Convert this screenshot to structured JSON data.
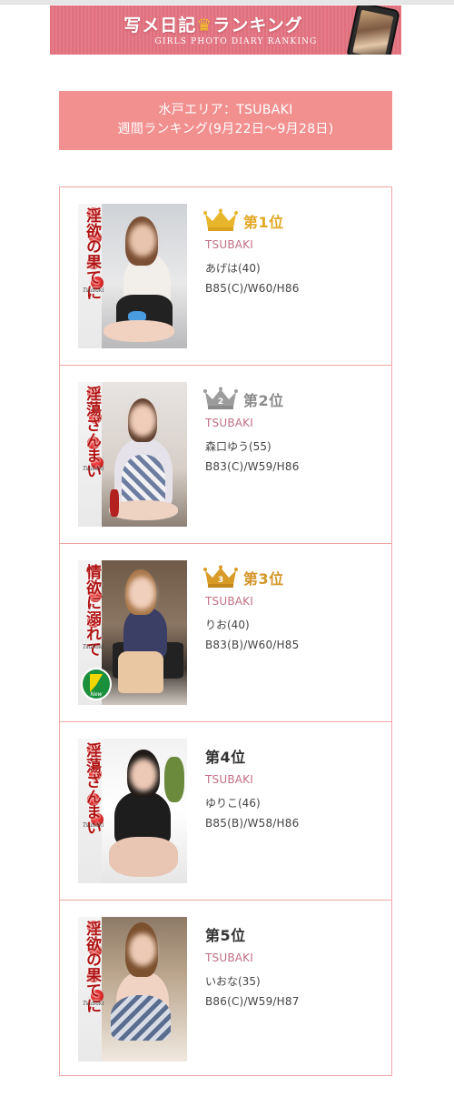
{
  "banner": {
    "title_left": "写メ日記",
    "title_crown": "♛",
    "title_right": "ランキング",
    "subtitle": "GIRLS PHOTO DIARY RANKING"
  },
  "heading": {
    "line1": "水戸エリア：TSUBAKI",
    "line2": "週間ランキング(9月22日〜9月28日)"
  },
  "colors": {
    "accent_pink": "#f28f8f",
    "border_pink": "#f0a5a5",
    "shop_name": "#c16f84",
    "gold": "#e8b62c",
    "silver": "#999999",
    "bronze": "#d49a2a"
  },
  "rankings": [
    {
      "rank_label": "第1位",
      "crown": "gold",
      "shop": "TSUBAKI",
      "name": "あげは(40)",
      "size": "B85(C)/W60/H86",
      "photo_caption": "淫欲の果てに",
      "photo_shop": "Tsubaki"
    },
    {
      "rank_label": "第2位",
      "crown": "silver",
      "crown_number": "2",
      "shop": "TSUBAKI",
      "name": "森口ゆう(55)",
      "size": "B83(C)/W59/H86",
      "photo_caption": "淫蕩ざんまい",
      "photo_shop": "Tsubaki"
    },
    {
      "rank_label": "第3位",
      "crown": "bronze",
      "crown_number": "3",
      "shop": "TSUBAKI",
      "name": "りお(40)",
      "size": "B83(B)/W60/H85",
      "photo_caption": "情欲に溺れて",
      "photo_shop": "Tsubaki",
      "photo_badge": "New"
    },
    {
      "rank_label": "第4位",
      "shop": "TSUBAKI",
      "name": "ゆりこ(46)",
      "size": "B85(B)/W58/H86",
      "photo_caption": "淫蕩ざんまい",
      "photo_shop": "Tsubaki"
    },
    {
      "rank_label": "第5位",
      "shop": "TSUBAKI",
      "name": "いおな(35)",
      "size": "B86(C)/W59/H87",
      "photo_caption": "淫欲の果てに",
      "photo_shop": "Tsubaki"
    }
  ]
}
